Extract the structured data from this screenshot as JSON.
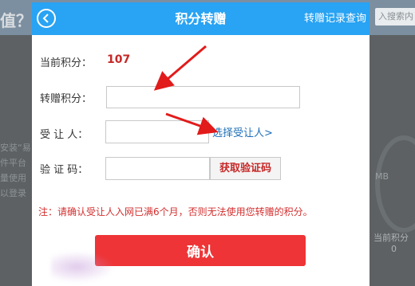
{
  "background": {
    "left_title": "值？",
    "left_texts": [
      "安装“易",
      "件平台",
      "量使用",
      "以登录"
    ],
    "search_placeholder": "入搜索内",
    "stat_label": "当前积分",
    "stat_value": "0",
    "unit": "MB"
  },
  "header": {
    "title": "积分转赠",
    "history_link": "转赠记录查询"
  },
  "form": {
    "current_points_label": "当前积分：",
    "current_points_value": "107",
    "transfer_label": "转赠积分：",
    "transfer_value": "",
    "recipient_label": "受 让 人：",
    "recipient_value": "",
    "select_recipient_link": "选择受让人>",
    "code_label": "验 证 码：",
    "code_value": "",
    "get_code_button": "获取验证码"
  },
  "notice": "注：请确认受让人入网已满6个月，否则无法使用您转赠的积分。",
  "confirm_button": "确认",
  "colors": {
    "header": "#29a3f3",
    "accent_red": "#ee3436",
    "notice_red": "#d32f2f",
    "link_blue": "#1e6fb8",
    "annotation_arrow": "#e21b1b"
  }
}
